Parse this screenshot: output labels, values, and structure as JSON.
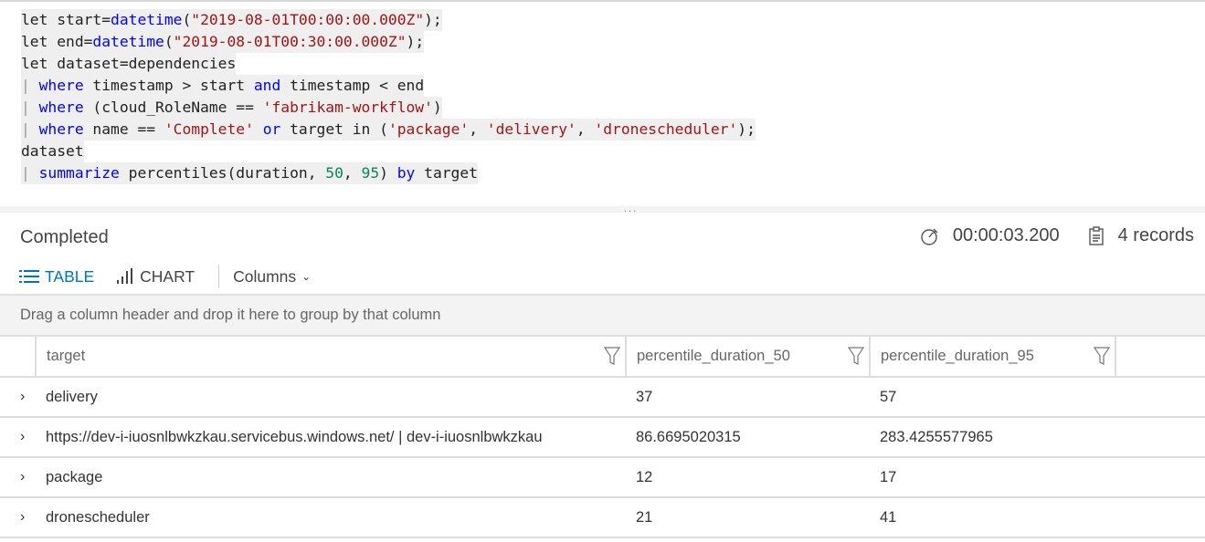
{
  "query": {
    "lines": [
      [
        {
          "t": "let start=",
          "c": "plain"
        },
        {
          "t": "datetime",
          "c": "kw"
        },
        {
          "t": "(",
          "c": "plain"
        },
        {
          "t": "\"2019-08-01T00:00:00.000Z\"",
          "c": "str"
        },
        {
          "t": ");",
          "c": "plain"
        }
      ],
      [
        {
          "t": "let end=",
          "c": "plain"
        },
        {
          "t": "datetime",
          "c": "kw"
        },
        {
          "t": "(",
          "c": "plain"
        },
        {
          "t": "\"2019-08-01T00:30:00.000Z\"",
          "c": "str"
        },
        {
          "t": ");",
          "c": "plain"
        }
      ],
      [
        {
          "t": "let dataset=dependencies",
          "c": "plain"
        }
      ],
      [
        {
          "t": "| ",
          "c": "pipe"
        },
        {
          "t": "where",
          "c": "kw"
        },
        {
          "t": " timestamp > start ",
          "c": "plain"
        },
        {
          "t": "and",
          "c": "kw"
        },
        {
          "t": " timestamp < end",
          "c": "plain"
        }
      ],
      [
        {
          "t": "| ",
          "c": "pipe"
        },
        {
          "t": "where",
          "c": "kw"
        },
        {
          "t": " (cloud_RoleName == ",
          "c": "plain"
        },
        {
          "t": "'fabrikam-workflow'",
          "c": "str"
        },
        {
          "t": ")",
          "c": "plain"
        }
      ],
      [
        {
          "t": "| ",
          "c": "pipe"
        },
        {
          "t": "where",
          "c": "kw"
        },
        {
          "t": " name == ",
          "c": "plain"
        },
        {
          "t": "'Complete'",
          "c": "str"
        },
        {
          "t": " ",
          "c": "plain"
        },
        {
          "t": "or",
          "c": "kw"
        },
        {
          "t": " target in (",
          "c": "plain"
        },
        {
          "t": "'package'",
          "c": "str"
        },
        {
          "t": ", ",
          "c": "plain"
        },
        {
          "t": "'delivery'",
          "c": "str"
        },
        {
          "t": ", ",
          "c": "plain"
        },
        {
          "t": "'dronescheduler'",
          "c": "str"
        },
        {
          "t": ");",
          "c": "plain"
        }
      ],
      [
        {
          "t": "dataset",
          "c": "plain"
        }
      ],
      [
        {
          "t": "| ",
          "c": "pipe"
        },
        {
          "t": "summarize",
          "c": "kw"
        },
        {
          "t": " percentiles(duration, ",
          "c": "plain"
        },
        {
          "t": "50",
          "c": "num"
        },
        {
          "t": ", ",
          "c": "plain"
        },
        {
          "t": "95",
          "c": "num"
        },
        {
          "t": ") ",
          "c": "plain"
        },
        {
          "t": "by",
          "c": "kw"
        },
        {
          "t": " target",
          "c": "plain"
        }
      ]
    ]
  },
  "splitter_dots": "...",
  "results": {
    "status": "Completed",
    "duration": "00:00:03.200",
    "records": "4 records",
    "icons": {
      "timer": "stopwatch-icon",
      "records": "clipboard-icon"
    }
  },
  "toolbar": {
    "table_label": "TABLE",
    "chart_label": "CHART",
    "columns_label": "Columns",
    "active_color": "#0072c6"
  },
  "group_bar_text": "Drag a column header and drop it here to group by that column",
  "table": {
    "columns": [
      "target",
      "percentile_duration_50",
      "percentile_duration_95"
    ],
    "rows": [
      {
        "target": "delivery",
        "p50": "37",
        "p95": "57"
      },
      {
        "target": "https://dev-i-iuosnlbwkzkau.servicebus.windows.net/ | dev-i-iuosnlbwkzkau",
        "p50": "86.6695020315",
        "p95": "283.4255577965"
      },
      {
        "target": "package",
        "p50": "12",
        "p95": "17"
      },
      {
        "target": "dronescheduler",
        "p50": "21",
        "p95": "41"
      }
    ]
  }
}
